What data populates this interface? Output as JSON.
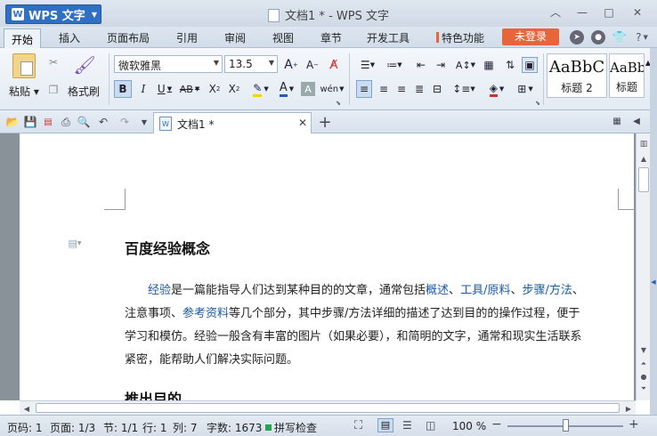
{
  "app": {
    "name": "WPS 文字",
    "window_title": "文档1 * - WPS 文字"
  },
  "menu": {
    "tabs": [
      "开始",
      "插入",
      "页面布局",
      "引用",
      "审阅",
      "视图",
      "章节",
      "开发工具",
      "特色功能"
    ],
    "login": "未登录",
    "help": "?"
  },
  "ribbon": {
    "paste_label": "粘贴",
    "format_painter_label": "格式刷",
    "font_name": "微软雅黑",
    "font_size": "13.5",
    "styles": [
      {
        "preview": "AaBbC",
        "name": "标题 2"
      },
      {
        "preview": "AaBb",
        "name": "标题"
      }
    ]
  },
  "document_tab": {
    "label": "文档1 *"
  },
  "document": {
    "heading": "百度经验概念",
    "para_lines": [
      [
        {
          "t": "经验",
          "link": true
        },
        {
          "t": "是一篇能指导人们达到某种目的的文章，通常包括"
        },
        {
          "t": "概述",
          "link": true
        },
        {
          "t": "、"
        },
        {
          "t": "工具/原料",
          "link": true
        },
        {
          "t": "、"
        },
        {
          "t": "步骤/方法",
          "link": true
        },
        {
          "t": "、"
        }
      ],
      [
        {
          "t": "注意事项、"
        },
        {
          "t": "参考资料",
          "link": true
        },
        {
          "t": "等几个部分，其中步骤/方法详细的描述了达到目的的操作过程，便于"
        }
      ],
      [
        {
          "t": "学习和模仿。经验一般含有丰富的图片（如果必要），和简明的文字，通常和现实生活联系"
        }
      ],
      [
        {
          "t": "紧密，能帮助人们解决实际问题。"
        }
      ]
    ],
    "next_heading": "推出目的"
  },
  "status": {
    "page_num": "页码: 1",
    "pages": "页面: 1/3",
    "section": "节: 1/1",
    "row": "行: 1",
    "col": "列: 7",
    "words": "字数: 1673",
    "spell": "拼写检查",
    "zoom": "100 %"
  },
  "colors": {
    "accent": "#2f6fc4",
    "login": "#e8653b",
    "link": "#1c5aa5"
  }
}
